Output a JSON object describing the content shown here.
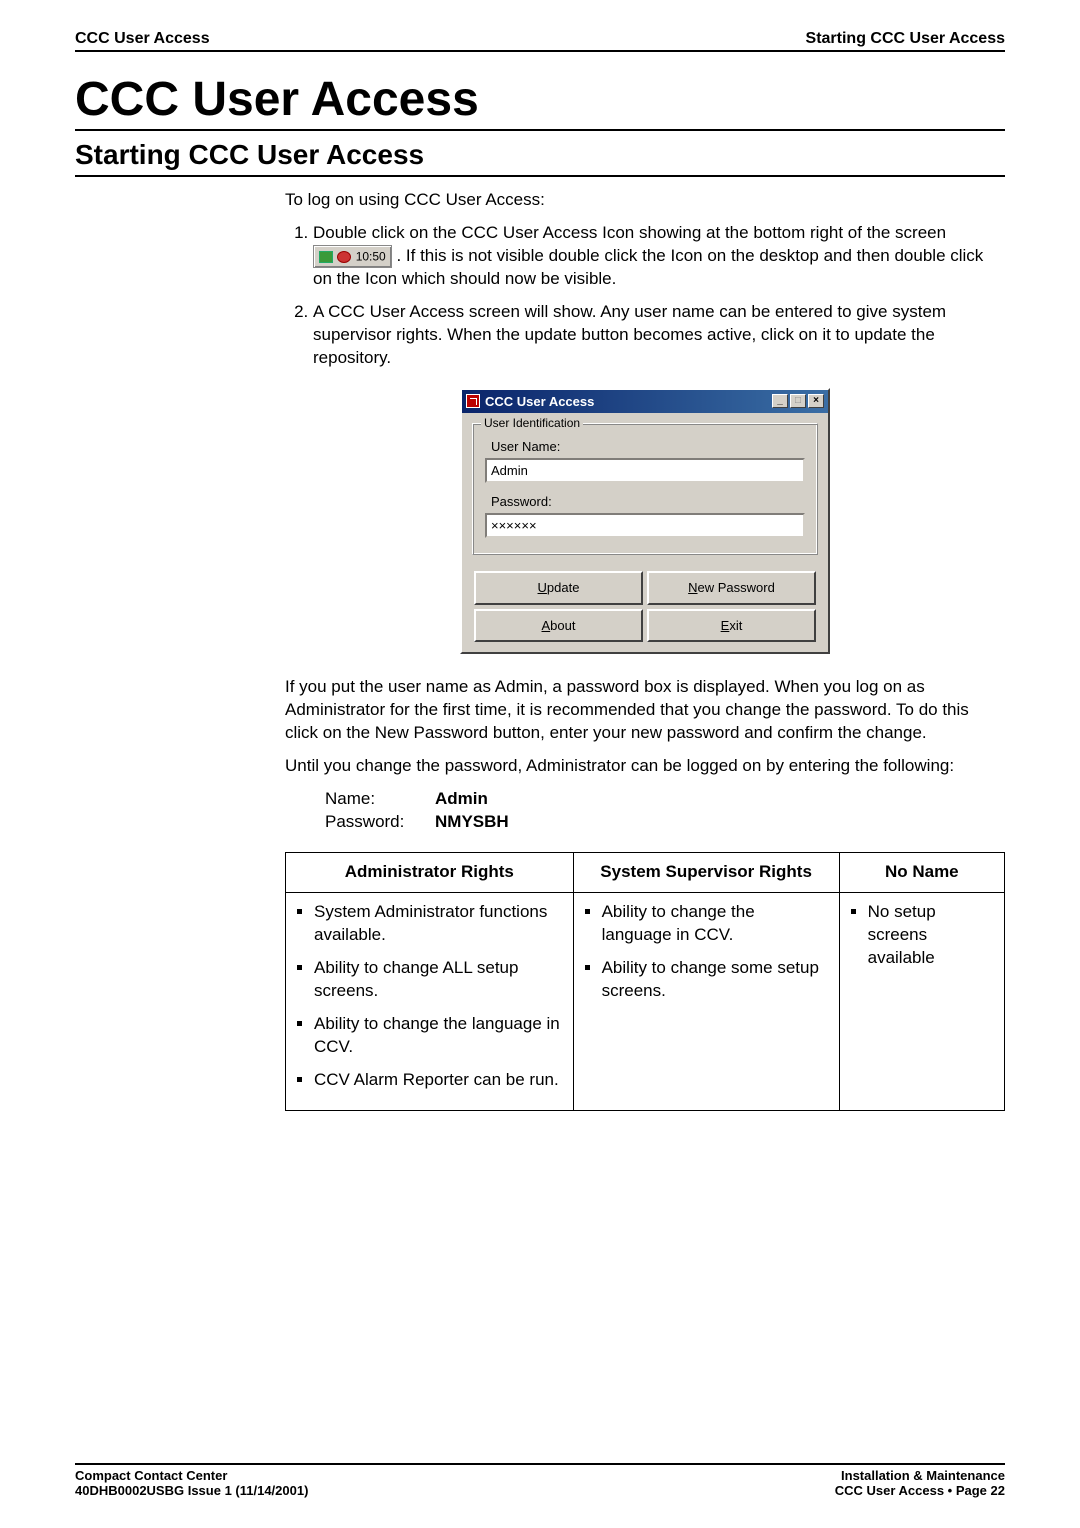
{
  "header": {
    "left": "CCC User Access",
    "right": "Starting CCC User Access"
  },
  "title": "CCC User Access",
  "section": "Starting CCC User Access",
  "intro": "To log on using CCC User Access:",
  "step1_a": "Double click on the CCC User Access Icon showing at the bottom right of the screen ",
  "step1_b": ". If this is not visible double click the Icon on the desktop and then double click on the Icon which should now be visible.",
  "tray_time": "10:50",
  "step2": "A CCC User Access screen will show.  Any user name can be entered to give system supervisor rights.  When the update button becomes active, click on it to update the repository.",
  "dialog": {
    "title": "CCC User Access",
    "group": "User Identification",
    "user_label": "User Name:",
    "user_value": "Admin",
    "pass_label": "Password:",
    "pass_value": "××××××",
    "btn_update": "pdate",
    "btn_update_u": "U",
    "btn_newpw": "ew Password",
    "btn_newpw_u": "N",
    "btn_about": "bout",
    "btn_about_u": "A",
    "btn_exit": "xit",
    "btn_exit_u": "E"
  },
  "para1": "If you put the user name as Admin, a password box is displayed.  When you log on as Administrator for the first time, it is recommended that you change the password.  To do this click on the New Password button, enter your new password and confirm the change.",
  "para2": "Until you change the password, Administrator can be logged on by entering the following:",
  "creds": {
    "name_k": "Name:",
    "name_v": "Admin",
    "pass_k": "Password:",
    "pass_v": "NMYSBH"
  },
  "table": {
    "h1": "Administrator Rights",
    "h2": "System Supervisor Rights",
    "h3": "No Name",
    "c1": [
      "System Administrator functions available.",
      "Ability to change ALL setup screens.",
      "Ability to change the language in CCV.",
      "CCV Alarm Reporter can be run."
    ],
    "c2": [
      "Ability to change the language in CCV.",
      "Ability to change some setup screens."
    ],
    "c3": [
      "No setup screens available"
    ]
  },
  "footer": {
    "l1": "Compact Contact Center",
    "l2": "40DHB0002USBG Issue 1 (11/14/2001)",
    "r1": "Installation & Maintenance",
    "r2": "CCC User Access • Page 22"
  }
}
